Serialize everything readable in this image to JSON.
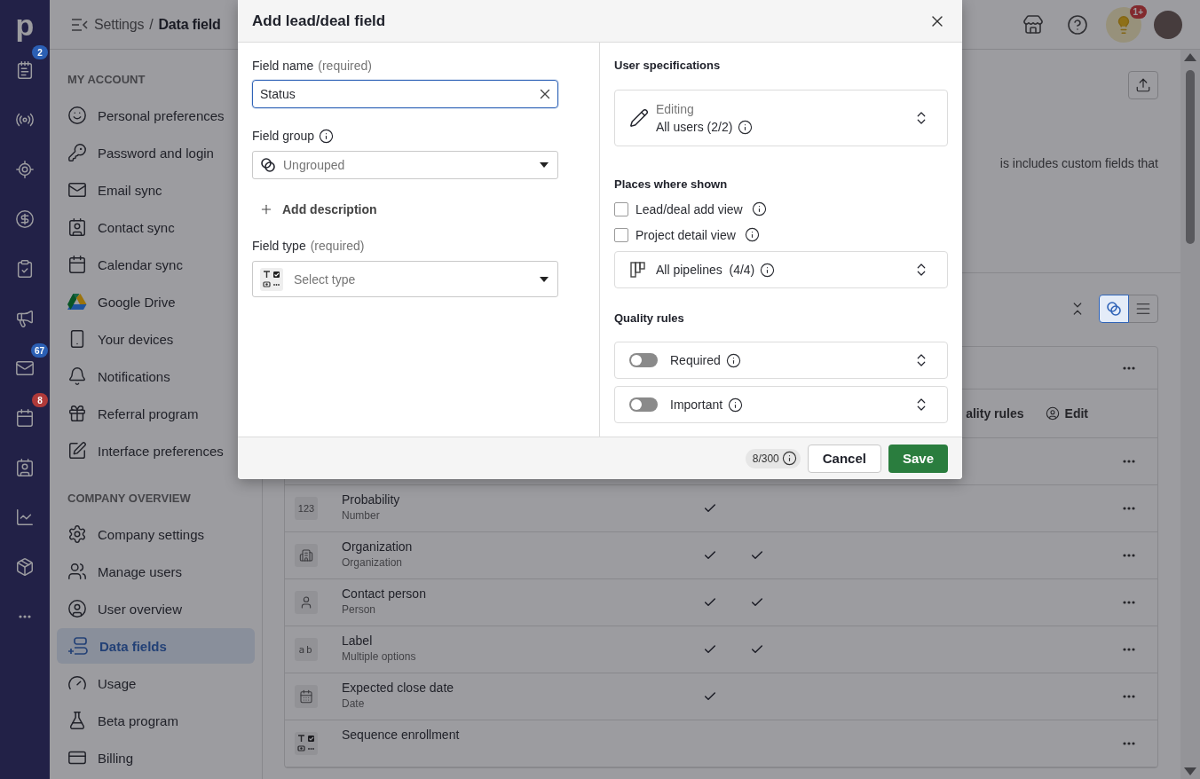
{
  "rail": {
    "logo": "p",
    "items": [
      {
        "kind": "notes",
        "badge": "2",
        "color": "#2b5fb4"
      },
      {
        "kind": "radio"
      },
      {
        "kind": "target"
      },
      {
        "kind": "dollar"
      },
      {
        "kind": "clipboard"
      },
      {
        "kind": "megaphone"
      },
      {
        "kind": "mail",
        "badge": "67",
        "color": "#2b5fb4"
      },
      {
        "kind": "calendar",
        "badge": "8",
        "color": "#b03a3a"
      },
      {
        "kind": "contact"
      },
      {
        "kind": "chart"
      },
      {
        "kind": "box"
      },
      {
        "kind": "more"
      }
    ]
  },
  "header": {
    "breadcrumb": [
      "Settings",
      "/",
      "Data field"
    ],
    "notification_badge": "1+"
  },
  "sidebar": {
    "sections": [
      {
        "heading": "MY ACCOUNT",
        "items": [
          {
            "kind": "smile",
            "label": "Personal preferences",
            "selected": false
          },
          {
            "kind": "key",
            "label": "Password and login",
            "selected": false
          },
          {
            "kind": "mail",
            "label": "Email sync",
            "selected": false
          },
          {
            "kind": "contact",
            "label": "Contact sync",
            "selected": false
          },
          {
            "kind": "calendar",
            "label": "Calendar sync",
            "selected": false
          },
          {
            "kind": "drive",
            "label": "Google Drive",
            "selected": false
          },
          {
            "kind": "phone",
            "label": "Your devices",
            "selected": false
          },
          {
            "kind": "bell",
            "label": "Notifications",
            "selected": false
          },
          {
            "kind": "gift",
            "label": "Referral program",
            "selected": false
          },
          {
            "kind": "edit",
            "label": "Interface preferences",
            "selected": false
          }
        ]
      },
      {
        "heading": "COMPANY OVERVIEW",
        "items": [
          {
            "kind": "gear",
            "label": "Company settings",
            "selected": false
          },
          {
            "kind": "users",
            "label": "Manage users",
            "selected": false
          },
          {
            "kind": "user",
            "label": "User overview",
            "selected": false
          },
          {
            "kind": "fields",
            "label": "Data fields",
            "selected": true
          },
          {
            "kind": "gauge",
            "label": "Usage",
            "selected": false
          },
          {
            "kind": "flask",
            "label": "Beta program",
            "selected": false
          },
          {
            "kind": "card",
            "label": "Billing",
            "selected": false
          }
        ]
      }
    ]
  },
  "page": {
    "description": "is includes custom fields that",
    "view_toggle": [
      {
        "kind": "groups",
        "selected": true
      },
      {
        "kind": "list",
        "selected": false
      }
    ]
  },
  "table": {
    "rows": [
      {
        "kind": "blank"
      },
      {
        "kind": "header",
        "columns": [
          "ality rules",
          "Edit"
        ]
      },
      {
        "kind": "blank"
      },
      {
        "kind": "number",
        "icon_text": "123",
        "name": "Probability",
        "type": "Number",
        "checks": [
          true,
          false
        ]
      },
      {
        "kind": "organization",
        "name": "Organization",
        "type": "Organization",
        "checks": [
          true,
          true
        ]
      },
      {
        "kind": "person",
        "name": "Contact person",
        "type": "Person",
        "checks": [
          true,
          true
        ]
      },
      {
        "kind": "label",
        "icon_text": "ab",
        "name": "Label",
        "type": "Multiple options",
        "checks": [
          true,
          true
        ]
      },
      {
        "kind": "date",
        "name": "Expected close date",
        "type": "Date",
        "checks": [
          true,
          false
        ]
      },
      {
        "kind": "mixed",
        "name": "Sequence enrollment",
        "checks": [
          false,
          false
        ]
      }
    ]
  },
  "modal": {
    "title": "Add lead/deal field",
    "field_name": {
      "label": "Field name",
      "hint": "(required)",
      "value": "Status"
    },
    "field_group": {
      "label": "Field group",
      "placeholder": "Ungrouped"
    },
    "add_description": "Add description",
    "field_type": {
      "label": "Field type",
      "hint": "(required)",
      "placeholder": "Select type"
    },
    "user_specifications": {
      "heading": "User specifications",
      "caption": "Editing",
      "value": "All users (2/2)"
    },
    "places": {
      "heading": "Places where shown",
      "options": [
        {
          "label": "Lead/deal add view",
          "checked": false
        },
        {
          "label": "Project detail view",
          "checked": false
        }
      ],
      "pipelines": "All pipelines  (4/4)"
    },
    "quality_rules": {
      "heading": "Quality rules",
      "rules": [
        {
          "label": "Required",
          "on": false
        },
        {
          "label": "Important",
          "on": false
        }
      ]
    },
    "footer": {
      "counter": "8/300",
      "cancel": "Cancel",
      "save": "Save"
    }
  }
}
